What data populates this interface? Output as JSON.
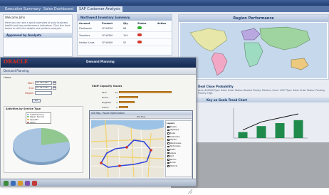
{
  "back_window": {
    "tabs": [
      "Executive Summary",
      "Sales Dashboard",
      "SAP Customer Analysis"
    ],
    "active_tab": "SAP Customer Analysis",
    "left_panel": {
      "title": "Welcome John",
      "text": "Here you can see a quick overview of your business health and key performance indicators. Click the links below to drill into details and perform analysis.",
      "section_title": "Approved by Analysts"
    },
    "inventory": {
      "title": "Northwest Inventory Summary",
      "columns": [
        "Account",
        "Product",
        "Qty",
        "Status",
        "Action"
      ],
      "rows": [
        {
          "account": "Fleetwood",
          "product": "CF-W200",
          "qty": "66",
          "status": "#2fae2f"
        },
        {
          "account": "Travelers",
          "product": "CF-W300",
          "qty": "104",
          "status": "#d6342a"
        },
        {
          "account": "Harbor Lines",
          "product": "CF-W400",
          "qty": "52",
          "status": "#d6342a"
        }
      ]
    },
    "region_title": "Region Performance",
    "deal_title": "Deal Close Probability",
    "deal_text": "Acct: #09409 Type: Sales Order Status: Booked Priority: Medium / Acct: 4397 Type: Sales Order Status: Pending Priority: High",
    "trend_title": "Key on Goals Trend Chart"
  },
  "front_window": {
    "logo": "ORACLE",
    "app_title": "Demand Planning",
    "crumb": "Demand Planning",
    "crumb2": "Home",
    "form": [
      {
        "label": "Start",
        "value": "07-18-2010"
      },
      {
        "label": "End",
        "value": "07-25-2010"
      },
      {
        "label": "Region",
        "value": ""
      }
    ],
    "go_label": "Go",
    "capacity": {
      "title": "Staff Capacity Issues",
      "rows": [
        {
          "label": "Tech",
          "value": "14",
          "fill": 0.92
        },
        {
          "label": "Driver",
          "value": "4",
          "fill": 0.34
        },
        {
          "label": "Engineer",
          "value": "3",
          "fill": 0.28
        },
        {
          "label": "Admin",
          "value": "2",
          "fill": 0.16
        }
      ]
    },
    "pie_panel": {
      "title": "Activities by Service Type",
      "legend": [
        {
          "label": "Install Service",
          "color": "#a8c4e0"
        },
        {
          "label": "Repair Service",
          "color": "#90c890"
        },
        {
          "label": "Upgrade",
          "color": "#e8c070"
        },
        {
          "label": "Other",
          "color": "#d08080"
        }
      ]
    },
    "map_window": {
      "title": "GIS Map - Route Optimization",
      "toolbar_label": "GIS Plus",
      "layers_title": "Layers",
      "layers": [
        "Streets",
        "Highways",
        "Route",
        "Customers",
        "Depots",
        "Warehouses",
        "Technicians",
        "Traffic",
        "Labels",
        "Grid",
        "Terrain",
        "Zones",
        "Districts"
      ]
    }
  },
  "chart_data": {
    "type": "bar",
    "categories": [
      "",
      "",
      "",
      ""
    ],
    "series": [
      {
        "values": [
          2,
          4,
          5,
          6
        ]
      }
    ],
    "ylim": [
      0,
      10
    ]
  }
}
